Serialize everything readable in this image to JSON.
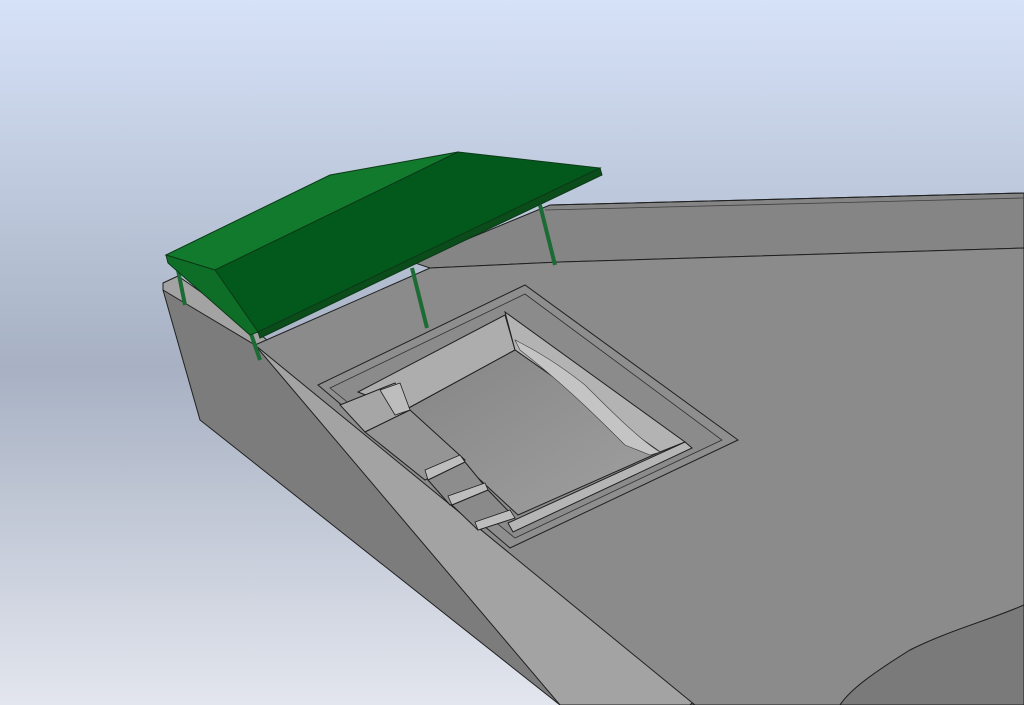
{
  "viewport": {
    "background_top": "#d6e2f8",
    "background_mid": "#a7b1c3",
    "background_bottom": "#e3e6ee"
  },
  "model": {
    "canopy_color_light": "#127a2c",
    "canopy_color_dark": "#03591c",
    "canopy_post_color": "#1d6b34",
    "deck_color": "#8b8b8b",
    "wall_side_color": "#7c7c7c",
    "wall_top_color": "#a3a3a3",
    "pool_floor_color": "#8f8f8f",
    "pool_wall_color": "#adadad",
    "edge_color": "#202020"
  }
}
